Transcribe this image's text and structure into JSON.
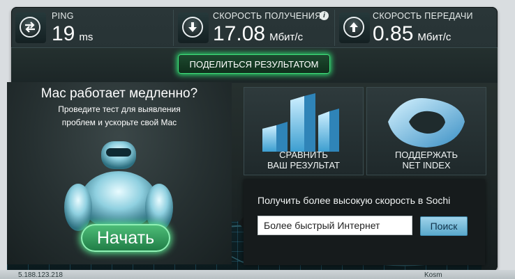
{
  "stats": {
    "ping": {
      "label": "PING",
      "value": "19",
      "unit": "ms"
    },
    "download": {
      "label": "СКОРОСТЬ ПОЛУЧЕНИЯ",
      "value": "17.08",
      "unit": "Мбит/с"
    },
    "upload": {
      "label": "СКОРОСТЬ ПЕРЕДАЧИ",
      "value": "0.85",
      "unit": "Мбит/с"
    },
    "info_icon": "i"
  },
  "share": {
    "label": "ПОДЕЛИТЬСЯ РЕЗУЛЬТАТОМ"
  },
  "ad": {
    "title": "Mac работает медленно?",
    "subtitle_line1": "Проведите тест для выявления",
    "subtitle_line2": "проблем и ускорьте свой Mac",
    "start_label": "Начать"
  },
  "tiles": {
    "compare_line1": "СРАВНИТЬ",
    "compare_line2": "ВАШ РЕЗУЛЬТАТ",
    "support_line1": "ПОДДЕРЖАТЬ",
    "support_line2": "NET INDEX"
  },
  "popup": {
    "text": "Получить более высокую скорость в Sochi",
    "input_value": "Более быстрый Интернет",
    "search_label": "Поиск"
  },
  "footer": {
    "ip_partial": "5.188.123.218",
    "corner_partial": "Kosm"
  },
  "colors": {
    "accent_green": "#2fd36e",
    "panel_bg": "#1f2b2d",
    "search_blue": "#5aa9cc"
  },
  "icons": [
    "ping-arrows-icon",
    "download-arrow-icon",
    "upload-arrow-icon",
    "info-icon",
    "robot-icon",
    "bar-chart-icon",
    "net-index-icon"
  ]
}
